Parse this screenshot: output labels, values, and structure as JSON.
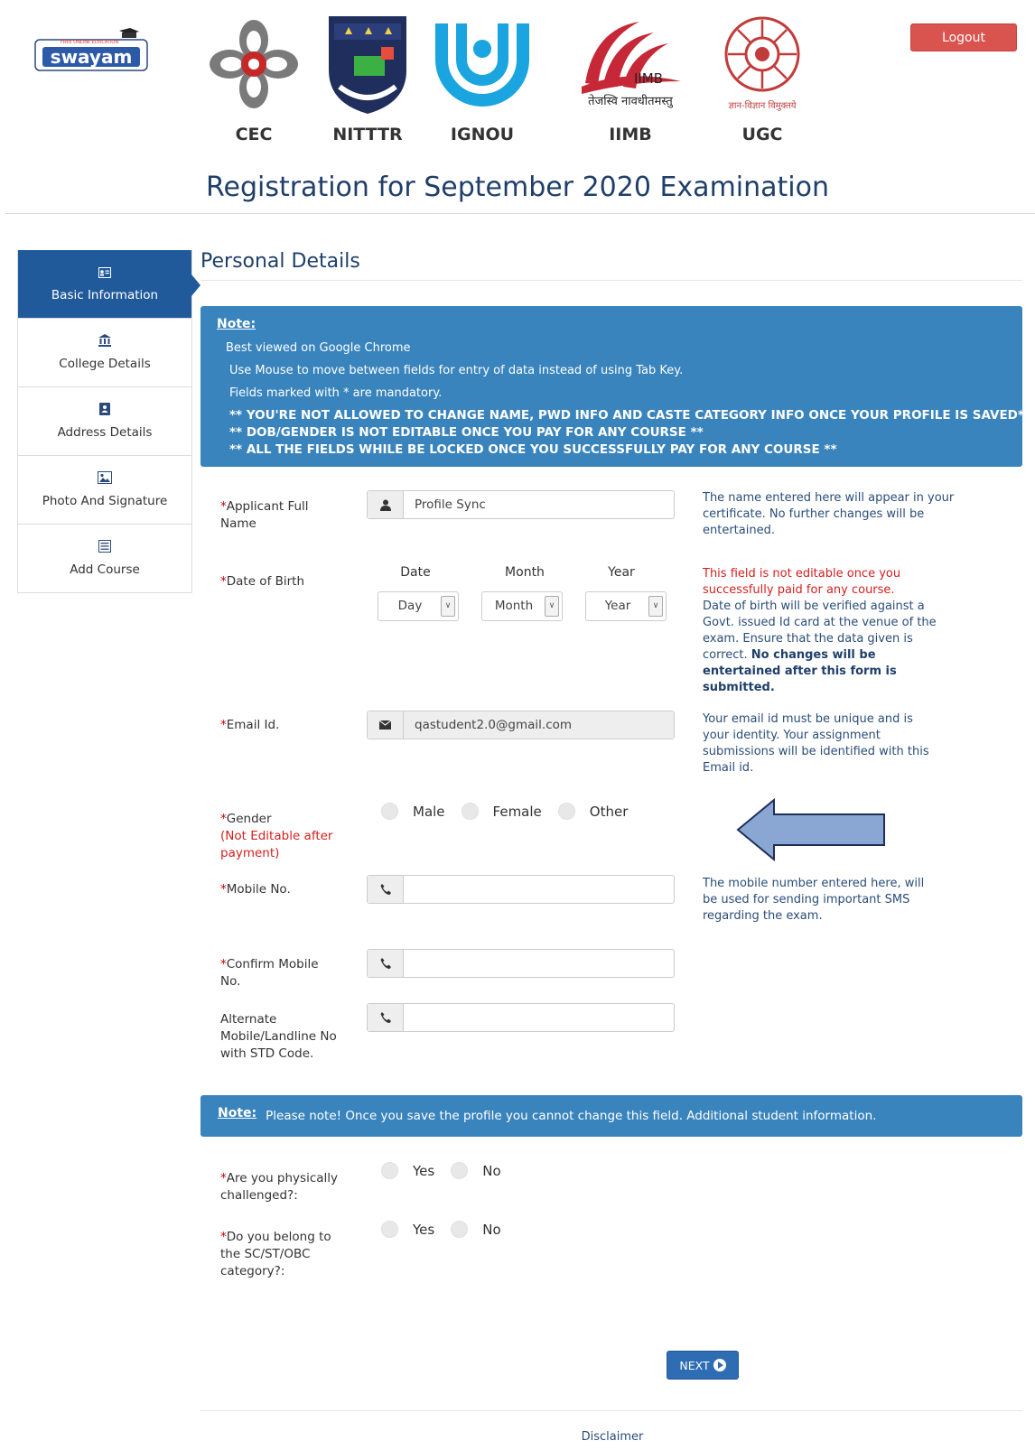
{
  "header": {
    "swayam_logo_text": "swayam",
    "swayam_tagline": "FREE ONLINE EDUCATION",
    "partners": [
      {
        "name": "CEC"
      },
      {
        "name": "NITTTR"
      },
      {
        "name": "IGNOU"
      },
      {
        "name": "IIMB",
        "logo_text": "IIMB",
        "motto": "तेजस्वि नावधीतमस्तु"
      },
      {
        "name": "UGC",
        "motto": "ज्ञान-विज्ञान विमुक्तये"
      }
    ],
    "logout_label": "Logout"
  },
  "page_title": "Registration for September 2020 Examination",
  "sidebar": {
    "items": [
      {
        "label": "Basic Information",
        "icon": "id-card-icon",
        "active": true
      },
      {
        "label": "College Details",
        "icon": "bank-icon"
      },
      {
        "label": "Address Details",
        "icon": "address-book-icon"
      },
      {
        "label": "Photo And Signature",
        "icon": "picture-icon"
      },
      {
        "label": "Add Course",
        "icon": "list-icon"
      }
    ]
  },
  "section_title": "Personal Details",
  "note1": {
    "heading": "Note:",
    "line1": "Best viewed on Google Chrome",
    "line2": "Use Mouse to move between fields for entry of data instead of using Tab Key.",
    "line3": "Fields marked with * are mandatory.",
    "bold1": "** YOU'RE NOT ALLOWED TO CHANGE NAME, PWD INFO AND CASTE CATEGORY INFO ONCE YOUR PROFILE IS SAVED**",
    "bold2": "** DOB/GENDER IS NOT EDITABLE ONCE YOU PAY FOR ANY COURSE **",
    "bold3": "** ALL THE FIELDS WHILE BE LOCKED ONCE YOU SUCCESSFULLY PAY FOR ANY COURSE **"
  },
  "form": {
    "name": {
      "label_line1": "Applicant Full",
      "label_line2": "Name",
      "value": "Profile Sync",
      "help": "The name entered here will appear in your certificate. No further changes will be entertained."
    },
    "dob": {
      "label": "Date of Birth",
      "col_date": "Date",
      "col_month": "Month",
      "col_year": "Year",
      "day_value": "Day",
      "month_value": "Month",
      "year_value": "Year",
      "help_red": "This field is not editable once you successfully paid for any course.",
      "help_normal": "Date of birth will be verified against a Govt. issued Id card at the venue of the exam. Ensure that the data given is correct.",
      "help_bold": "No changes will be entertained after this form is submitted."
    },
    "email": {
      "label": "Email Id.",
      "value": "qastudent2.0@gmail.com",
      "help": "Your email id must be unique and is your identity. Your assignment submissions will be identified with this Email id."
    },
    "gender": {
      "label": "Gender",
      "note": "(Not Editable after payment)",
      "options": [
        "Male",
        "Female",
        "Other"
      ]
    },
    "mobile": {
      "label": "Mobile No.",
      "value": "",
      "help": "The mobile number entered here, will be used for sending important SMS regarding the exam."
    },
    "confirm_mobile": {
      "label_line1": "Confirm Mobile",
      "label_line2": "No.",
      "value": ""
    },
    "alt_mobile": {
      "label_line1": "Alternate",
      "label_line2": "Mobile/Landline No",
      "label_line3": "with STD Code.",
      "value": ""
    }
  },
  "note2": {
    "heading": "Note:",
    "text": "Please note! Once you save the profile you cannot change this field. Additional student information."
  },
  "questions": {
    "pwd": {
      "label_line1": "Are you physically",
      "label_line2": "challenged?:",
      "options": [
        "Yes",
        "No"
      ]
    },
    "caste": {
      "label_line1": "Do you belong to",
      "label_line2": "the SC/ST/OBC",
      "label_line3": "category?:",
      "options": [
        "Yes",
        "No"
      ]
    }
  },
  "next_label": "NEXT",
  "footer": {
    "disclaimer": "Disclaimer"
  },
  "colors": {
    "accent": "#215a9b",
    "note_bg": "#3a84bd",
    "logout": "#d9534f",
    "error": "#d42020"
  }
}
